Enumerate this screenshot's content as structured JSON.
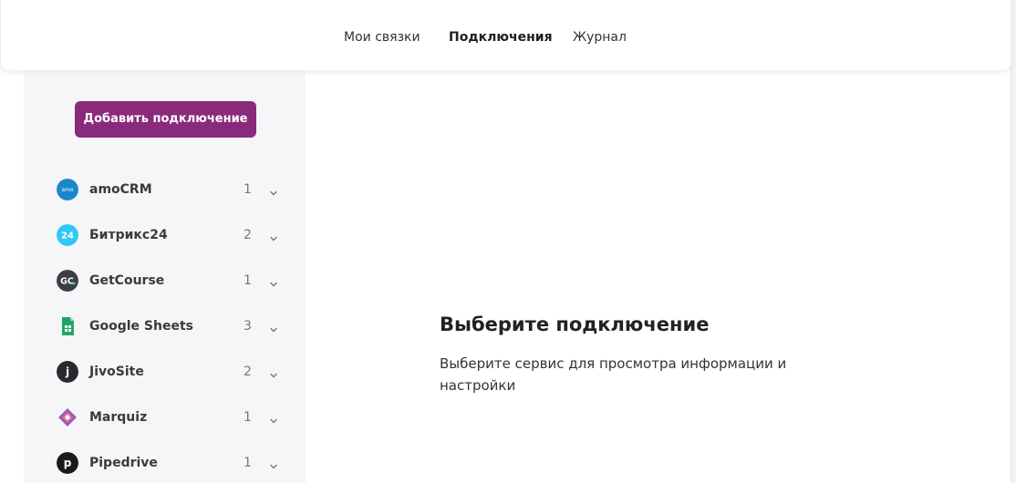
{
  "header": {
    "tabs": [
      {
        "label": "Мои связки",
        "active": false
      },
      {
        "label": "Подключения",
        "active": true
      },
      {
        "label": "Журнал",
        "active": false
      }
    ]
  },
  "sidebar": {
    "add_button_label": "Добавить подключение",
    "services": [
      {
        "name": "amoCRM",
        "count": "1",
        "icon": "amocrm-icon"
      },
      {
        "name": "Битрикс24",
        "count": "2",
        "icon": "bitrix24-icon"
      },
      {
        "name": "GetCourse",
        "count": "1",
        "icon": "getcourse-icon"
      },
      {
        "name": "Google Sheets",
        "count": "3",
        "icon": "google-sheets-icon"
      },
      {
        "name": "JivoSite",
        "count": "2",
        "icon": "jivosite-icon"
      },
      {
        "name": "Marquiz",
        "count": "1",
        "icon": "marquiz-icon"
      },
      {
        "name": "Pipedrive",
        "count": "1",
        "icon": "pipedrive-icon"
      }
    ]
  },
  "main": {
    "empty_title": "Выберите подключение",
    "empty_description": "Выберите сервис для просмотра информации и настройки"
  },
  "colors": {
    "accent": "#8a2a7b",
    "sidebar_bg": "#f6f6f9"
  },
  "icon_glyphs": {
    "amocrm": "amo",
    "bitrix24": "24",
    "getcourse": "GC",
    "jivosite": "j",
    "pipedrive": "p"
  }
}
